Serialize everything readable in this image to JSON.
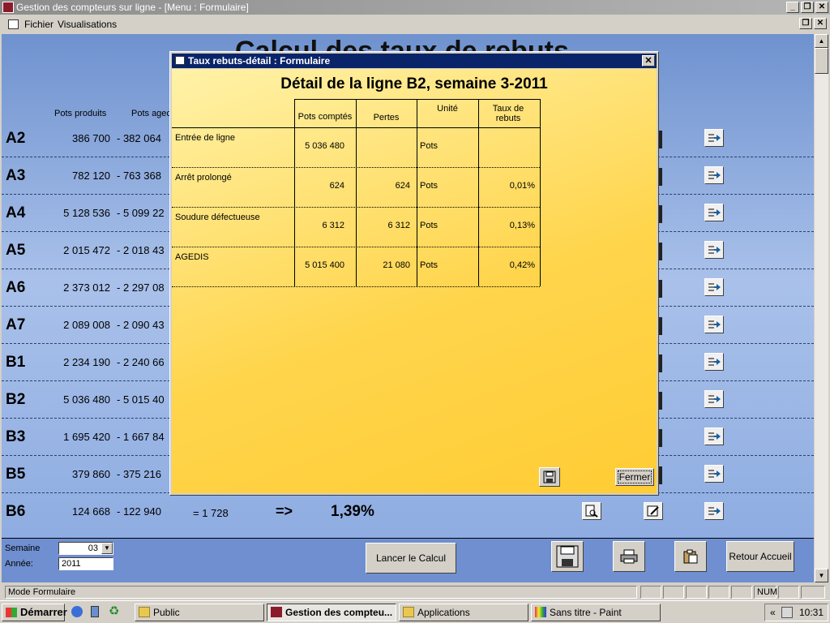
{
  "window": {
    "title": "Gestion des compteurs sur ligne - [Menu : Formulaire]",
    "btn_min": "_",
    "btn_restore": "❐",
    "btn_close": "✕",
    "child_restore": "❐",
    "child_close": "✕"
  },
  "menu": {
    "items": [
      "Fichier",
      "Visualisations"
    ]
  },
  "form": {
    "title": "Calcul des taux de rebuts",
    "col_pots_produits": "Pots produits",
    "col_pots_agec": "Pots agec",
    "rows": [
      {
        "label": "A2",
        "produits": "386 700",
        "agec": "- 382 064"
      },
      {
        "label": "A3",
        "produits": "782 120",
        "agec": "- 763 368"
      },
      {
        "label": "A4",
        "produits": "5 128 536",
        "agec": "- 5 099 22"
      },
      {
        "label": "A5",
        "produits": "2 015 472",
        "agec": "- 2 018 43"
      },
      {
        "label": "A6",
        "produits": "2 373 012",
        "agec": "- 2 297 08"
      },
      {
        "label": "A7",
        "produits": "2 089 008",
        "agec": "- 2 090 43"
      },
      {
        "label": "B1",
        "produits": "2 234 190",
        "agec": "- 2 240 66"
      },
      {
        "label": "B2",
        "produits": "5 036 480",
        "agec": "- 5 015 40"
      },
      {
        "label": "B3",
        "produits": "1 695 420",
        "agec": "- 1 667 84"
      },
      {
        "label": "B5",
        "produits": "379 860",
        "agec": "- 375 216"
      },
      {
        "label": "B6",
        "produits": "124 668",
        "agec": "- 122 940",
        "diff": "= 1 728",
        "arrow": "=>",
        "taux": "1,39%"
      }
    ]
  },
  "controls": {
    "semaine_label": "Semaine",
    "semaine_value": "03",
    "semaine_arrow": "▼",
    "annee_label": "Année:",
    "annee_value": "2011",
    "lancer": "Lancer le Calcul",
    "retour": "Retour Accueil"
  },
  "dialog": {
    "title": "Taux rebuts-détail : Formulaire",
    "close": "✕",
    "heading": "Détail de la ligne B2, semaine 3-2011",
    "headers": [
      "Pots comptés",
      "Pertes",
      "Unité",
      "Taux de rebuts"
    ],
    "rows": [
      {
        "label": "Entrée de ligne",
        "comptes": "5 036 480",
        "pertes": "",
        "unite": "Pots",
        "taux": ""
      },
      {
        "label": "Arrêt prolongé",
        "comptes": "624",
        "pertes": "624",
        "unite": "Pots",
        "taux": "0,01%"
      },
      {
        "label": "Soudure défectueuse",
        "comptes": "6 312",
        "pertes": "6 312",
        "unite": "Pots",
        "taux": "0,13%"
      },
      {
        "label": "AGEDIS",
        "comptes": "5 015 400",
        "pertes": "21 080",
        "unite": "Pots",
        "taux": "0,42%"
      }
    ],
    "fermer": "Fermer"
  },
  "status": {
    "mode": "Mode Formulaire",
    "num": "NUM"
  },
  "taskbar": {
    "start": "Démarrer",
    "tasks": [
      "Public",
      "Gestion des compteu...",
      "Applications",
      "Sans titre - Paint"
    ],
    "clock": "10:31",
    "tray_chevron": "«"
  }
}
